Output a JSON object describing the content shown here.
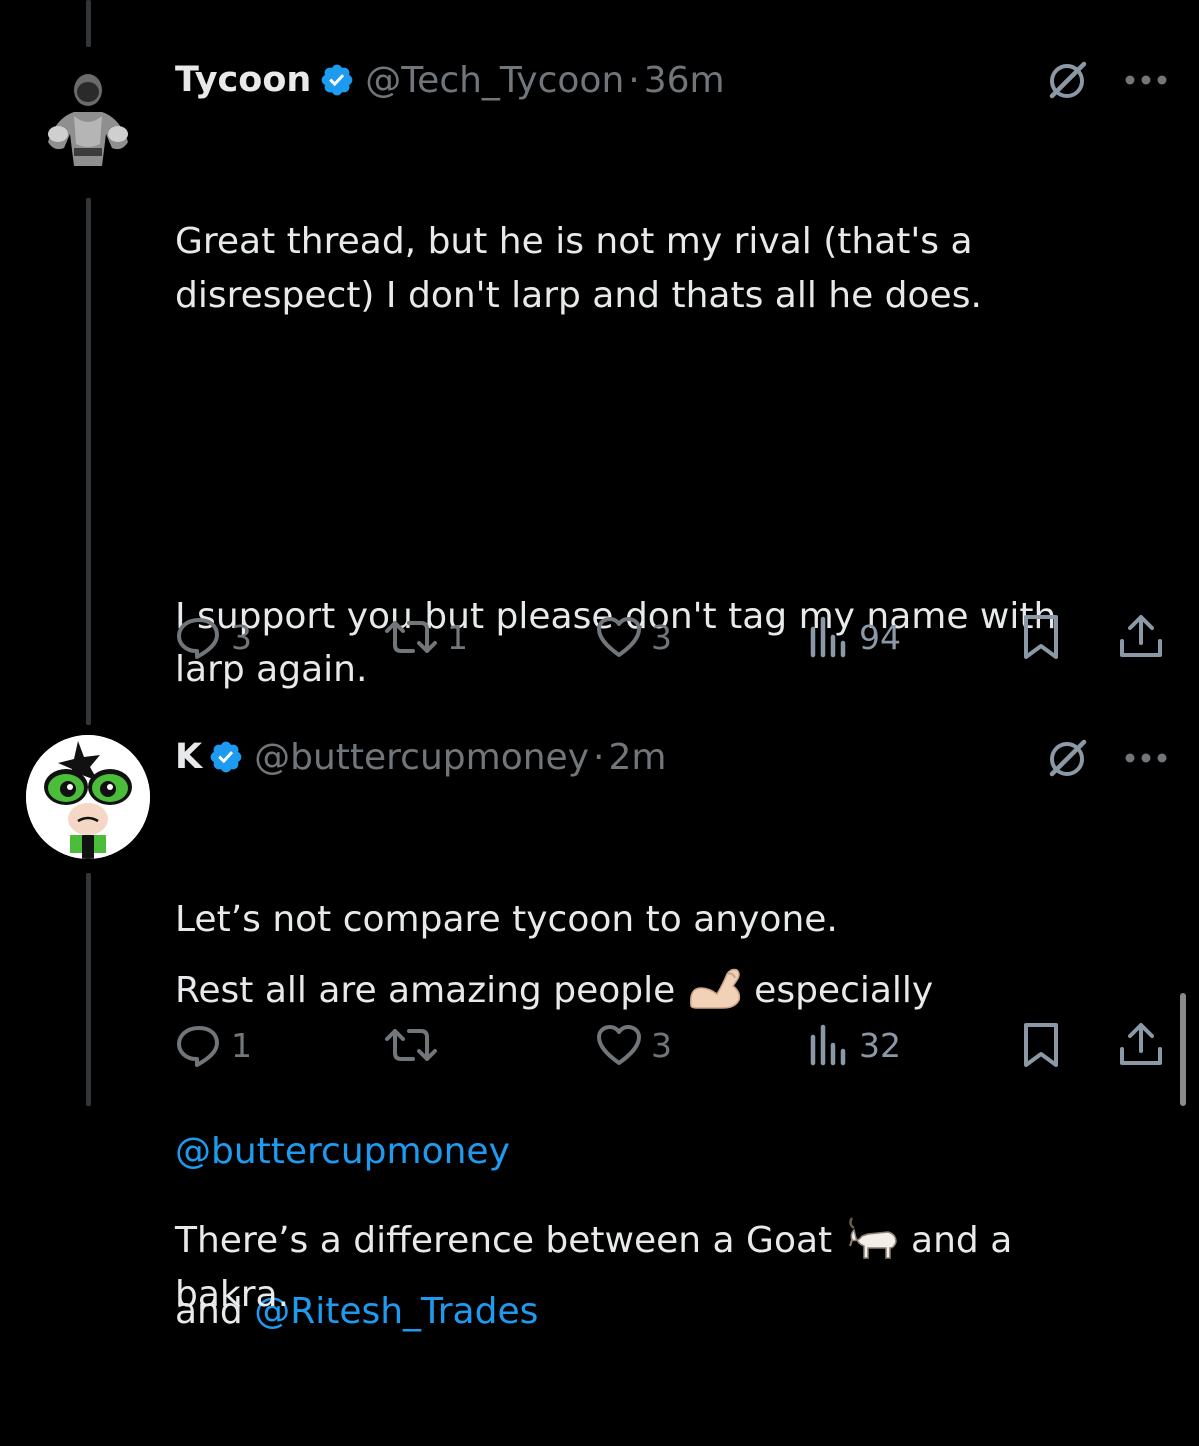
{
  "tweets": [
    {
      "name": "Tycoon",
      "handle": "@Tech_Tycoon",
      "dot": "·",
      "time": "36m",
      "avatar_icon": "bodybuilder-avatar",
      "paragraphs": [
        "Great thread, but he is not my rival (that's a disrespect) I don't larp and thats all he does.",
        "I support you but please don't tag my name with larp again."
      ],
      "line3_text": "Rest all are amazing people",
      "line3_emoji": "flexed-biceps-emoji",
      "line3_after": "especially",
      "mention1": "@buttercupmoney",
      "and_text": "and",
      "mention2": "@Ritesh_Trades",
      "replies": "3",
      "reposts": "1",
      "likes": "3",
      "views": "94"
    },
    {
      "name": "K",
      "handle": "@buttercupmoney",
      "dot": "·",
      "time": "2m",
      "avatar_icon": "buttercup-avatar",
      "line1": "Let’s not compare tycoon to anyone.",
      "line2_text": "There’s a difference between a Goat",
      "line2_emoji": "goat-emoji",
      "line2_after": "and a bakra.",
      "replies": "1",
      "reposts": "",
      "likes": "3",
      "views": "32"
    }
  ],
  "colors": {
    "background": "#000000",
    "text": "#e7e9ea",
    "muted": "#71767b",
    "link": "#1d9bf0",
    "verified": "#1d9bf0",
    "thread_line": "#333639"
  }
}
